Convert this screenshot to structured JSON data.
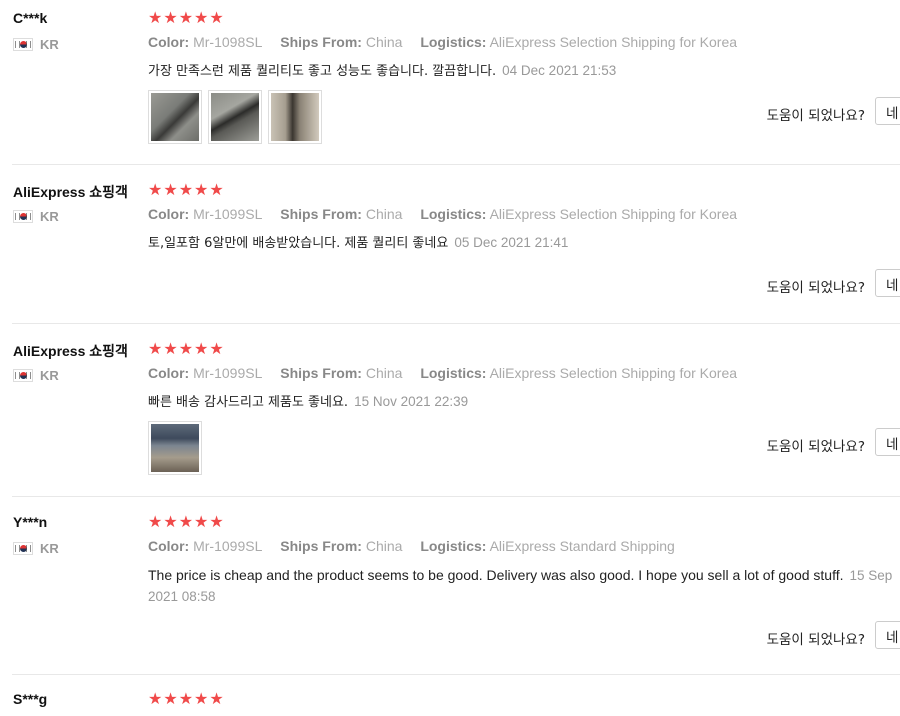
{
  "reviews": [
    {
      "user": "C***k",
      "country": "KR",
      "stars": "★★★★★",
      "color_label": "Color:",
      "color_value": "Mr-1098SL",
      "ships_label": "Ships From:",
      "ships_value": "China",
      "logistics_label": "Logistics:",
      "logistics_value": "AliExpress Selection Shipping for Korea",
      "text": "가장 만족스런 제품 퀄리티도 좋고 성능도 좋습니다. 깔끔합니다.",
      "date": "04 Dec 2021 21:53",
      "helpful": "도움이 되었나요?",
      "yes": "네",
      "photos": [
        "photo-knife-1",
        "photo-knife-2",
        "photo-knife-3"
      ]
    },
    {
      "user": "AliExpress 쇼핑객",
      "country": "KR",
      "stars": "★★★★★",
      "color_label": "Color:",
      "color_value": "Mr-1099SL",
      "ships_label": "Ships From:",
      "ships_value": "China",
      "logistics_label": "Logistics:",
      "logistics_value": "AliExpress Selection Shipping for Korea",
      "text": "토,일포함 6알만에 배송받았습니다. 제품 퀄리티 좋네요",
      "date": "05 Dec 2021 21:41",
      "helpful": "도움이 되었나요?",
      "yes": "네"
    },
    {
      "user": "AliExpress 쇼핑객",
      "country": "KR",
      "stars": "★★★★★",
      "color_label": "Color:",
      "color_value": "Mr-1099SL",
      "ships_label": "Ships From:",
      "ships_value": "China",
      "logistics_label": "Logistics:",
      "logistics_value": "AliExpress Selection Shipping for Korea",
      "text": "빠른 배송 감사드리고 제품도 좋네요.",
      "date": "15 Nov 2021 22:39",
      "helpful": "도움이 되었나요?",
      "yes": "네",
      "photos": [
        "photo-bottle"
      ]
    },
    {
      "user": "Y***n",
      "country": "KR",
      "stars": "★★★★★",
      "color_label": "Color:",
      "color_value": "Mr-1099SL",
      "ships_label": "Ships From:",
      "ships_value": "China",
      "logistics_label": "Logistics:",
      "logistics_value": "AliExpress Standard Shipping",
      "text": "The price is cheap and the product seems to be good. Delivery was also good. I hope you sell a lot of good stuff.",
      "date": "15 Sep 2021 08:58",
      "helpful": "도움이 되었나요?",
      "yes": "네"
    },
    {
      "user": "S***g",
      "stars": "★★★★★"
    }
  ],
  "colors": {
    "star": "#f04a4a",
    "muted": "#999999",
    "separator": "#e8e8e8"
  }
}
